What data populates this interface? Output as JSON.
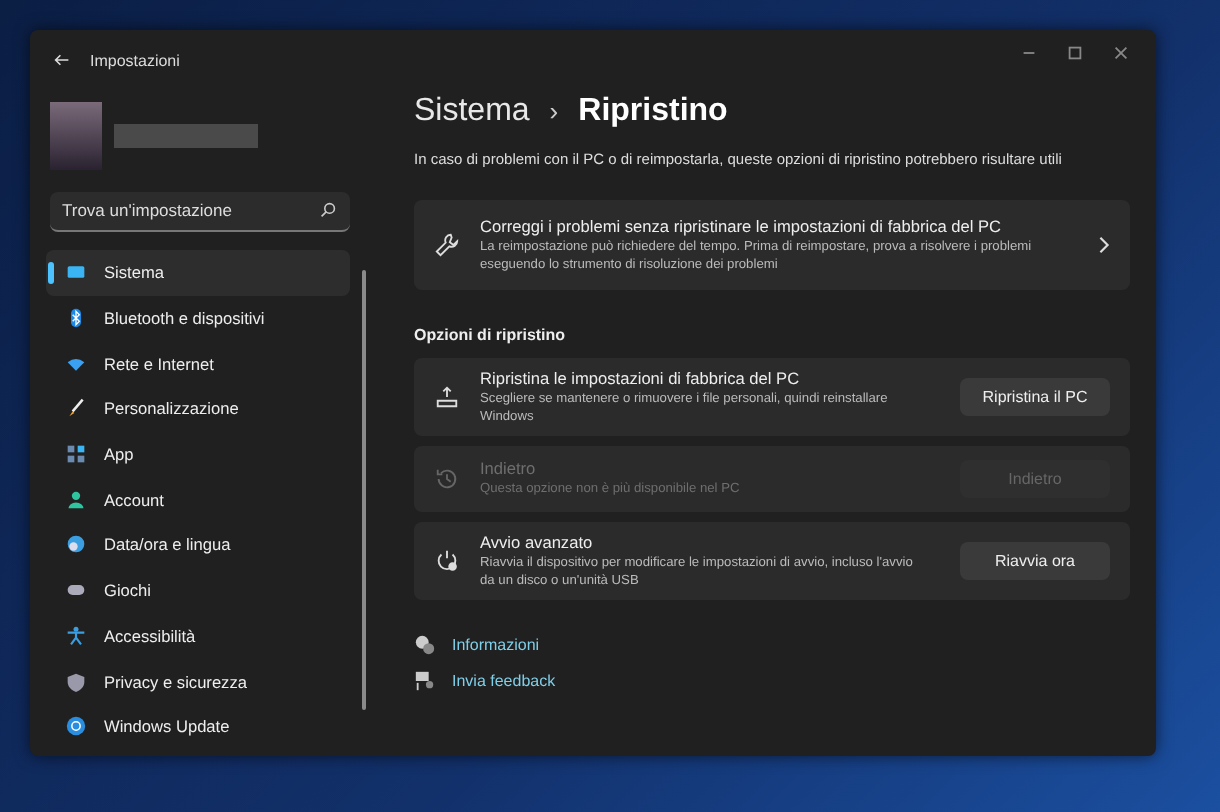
{
  "window": {
    "title": "Impostazioni"
  },
  "search": {
    "placeholder": "Trova un'impostazione"
  },
  "nav": [
    {
      "label": "Sistema",
      "selected": true
    },
    {
      "label": "Bluetooth e dispositivi",
      "selected": false
    },
    {
      "label": "Rete e Internet",
      "selected": false
    },
    {
      "label": "Personalizzazione",
      "selected": false
    },
    {
      "label": "App",
      "selected": false
    },
    {
      "label": "Account",
      "selected": false
    },
    {
      "label": "Data/ora e lingua",
      "selected": false
    },
    {
      "label": "Giochi",
      "selected": false
    },
    {
      "label": "Accessibilità",
      "selected": false
    },
    {
      "label": "Privacy e sicurezza",
      "selected": false
    },
    {
      "label": "Windows Update",
      "selected": false
    }
  ],
  "breadcrumb": {
    "parent": "Sistema",
    "separator": "›",
    "current": "Ripristino"
  },
  "description": "In caso di problemi con il PC o di reimpostarla, queste opzioni di ripristino potrebbero risultare utili",
  "fix_card": {
    "title": "Correggi i problemi senza ripristinare le impostazioni di fabbrica del PC",
    "description": "La reimpostazione può richiedere del tempo. Prima di reimpostare, prova a risolvere i problemi eseguendo lo strumento di risoluzione dei problemi"
  },
  "section_title": "Opzioni di ripristino",
  "options": [
    {
      "title": "Ripristina le impostazioni di fabbrica del PC",
      "description": "Scegliere se mantenere o rimuovere i file personali, quindi reinstallare Windows",
      "button": "Ripristina il PC",
      "disabled": false
    },
    {
      "title": "Indietro",
      "description": "Questa opzione non è più disponibile nel PC",
      "button": "Indietro",
      "disabled": true
    },
    {
      "title": "Avvio avanzato",
      "description": "Riavvia il dispositivo per modificare le impostazioni di avvio, incluso l'avvio da un disco o un'unità USB",
      "button": "Riavvia ora",
      "disabled": false
    }
  ],
  "links": [
    "Informazioni",
    "Invia feedback"
  ]
}
